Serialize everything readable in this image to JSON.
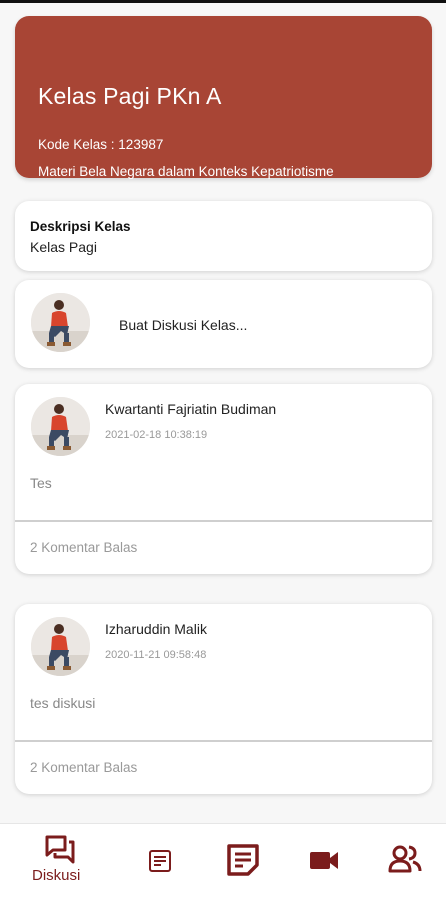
{
  "class_header": {
    "title": "Kelas Pagi PKn A",
    "code": "Kode Kelas : 123987",
    "subject": "Materi Bela Negara dalam Konteks Kepatriotisme",
    "background_color": "#a84535"
  },
  "description": {
    "title": "Deskripsi Kelas",
    "value": "Kelas Pagi"
  },
  "create_discussion": {
    "label": "Buat Diskusi Kelas..."
  },
  "posts": [
    {
      "author": "Kwartanti Fajriatin Budiman",
      "date": "2021-02-18 10:38:19",
      "body": "Tes",
      "replies": "2 Komentar Balas"
    },
    {
      "author": "Izharuddin Malik",
      "date": "2020-11-21 09:58:48",
      "body": "tes diskusi",
      "replies": "2 Komentar Balas"
    }
  ],
  "bottom_nav": {
    "accent_color": "#7b1c1c",
    "items": [
      {
        "icon": "forum-icon",
        "label": "Diskusi",
        "active": true
      },
      {
        "icon": "assignment-icon",
        "active": false
      },
      {
        "icon": "notes-icon",
        "active": false
      },
      {
        "icon": "video-icon",
        "active": false
      },
      {
        "icon": "people-icon",
        "active": false
      }
    ]
  }
}
